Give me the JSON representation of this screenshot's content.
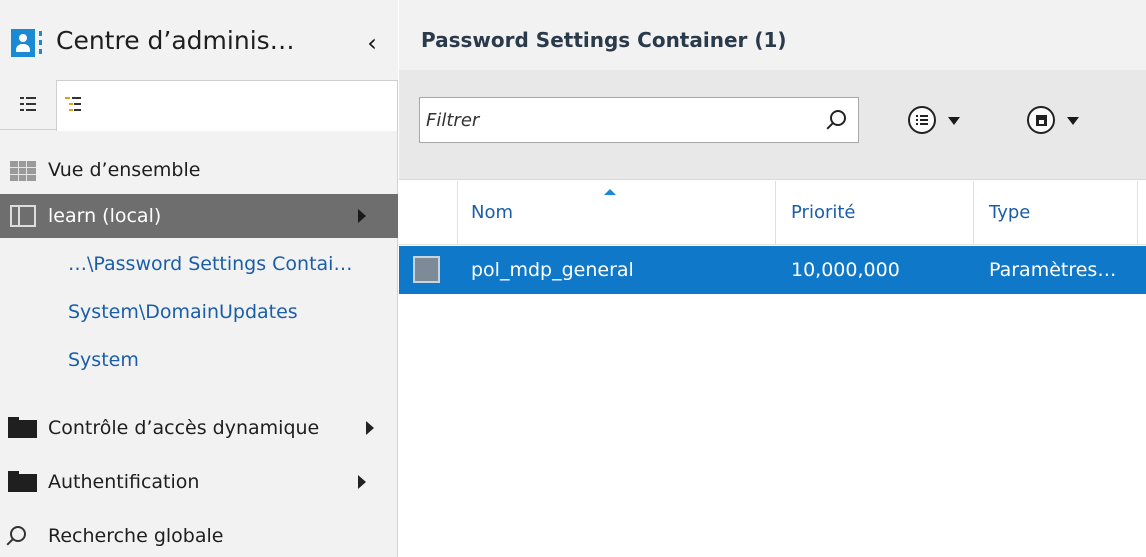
{
  "sidebar": {
    "app_title": "Centre d’adminis…",
    "collapse_glyph": "‹",
    "view_tabs": [
      {
        "name": "list-view",
        "icon": "list-view-icon"
      },
      {
        "name": "tree-view",
        "icon": "tree-view-icon"
      }
    ],
    "items": [
      {
        "label": "Vue d’ensemble",
        "icon": "overview-grid-icon"
      },
      {
        "label": "learn (local)",
        "icon": "domain-icon",
        "selected": true
      },
      {
        "label": "…\\Password Settings Contai…",
        "sub": true
      },
      {
        "label": "System\\DomainUpdates",
        "sub": true
      },
      {
        "label": "System",
        "sub": true
      },
      {
        "label": "Contrôle d’accès dynamique",
        "icon": "folder-icon"
      },
      {
        "label": "Authentification",
        "icon": "folder-icon"
      },
      {
        "label": "Recherche globale",
        "icon": "search-icon"
      }
    ]
  },
  "main": {
    "title": "Password Settings Container  (1)",
    "filter_placeholder": "Filtrer",
    "columns": [
      "Nom",
      "Priorité",
      "Type"
    ],
    "rows": [
      {
        "name": "pol_mdp_general",
        "priority": "10,000,000",
        "type": "Paramètres…"
      }
    ]
  },
  "colors": {
    "accent": "#1a8ad4",
    "selection": "#0f78c8",
    "nav_selected": "#6e6e6e",
    "link": "#1b5ea8"
  }
}
